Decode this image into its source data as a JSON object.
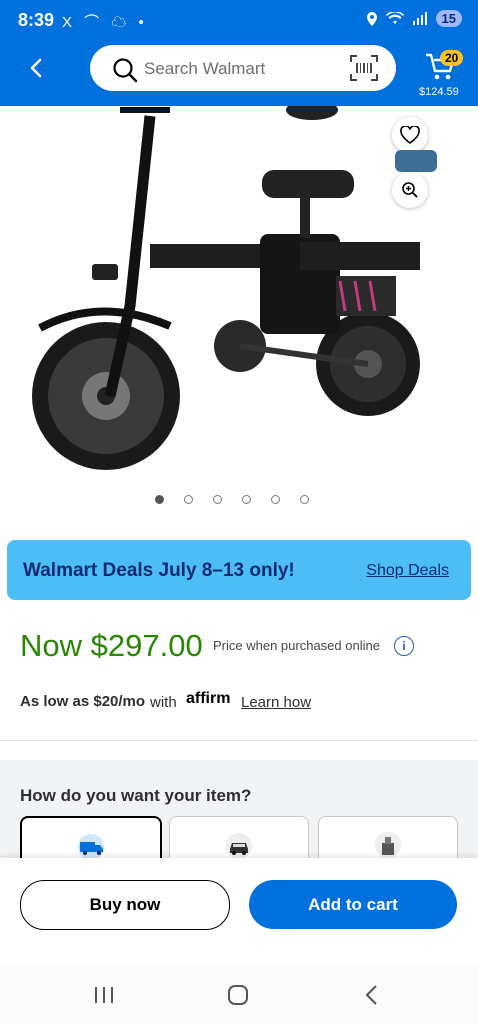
{
  "status_bar": {
    "time": "8:39",
    "left_icons": "X ⌒ ☁ •",
    "battery": "15"
  },
  "header": {
    "search_placeholder": "Search Walmart",
    "cart_count": "20",
    "cart_total": "$124.59"
  },
  "gallery": {
    "total_images": 6,
    "active_index": 0
  },
  "deals_banner": {
    "text": "Walmart Deals July 8–13 only!",
    "link": "Shop Deals"
  },
  "pricing": {
    "price": "Now $297.00",
    "note": "Price when purchased online",
    "as_low_as": "As low as $20/mo",
    "with": "with",
    "affirm_logo": "affirm",
    "learn_how": "Learn how"
  },
  "fulfillment": {
    "title": "How do you want your item?"
  },
  "actions": {
    "buy_now": "Buy now",
    "add_to_cart": "Add to cart"
  },
  "colors": {
    "brand_blue": "#0071dc",
    "price_green": "#2a8703",
    "banner_blue": "#4dbdf5",
    "badge_yellow": "#ffc220"
  }
}
